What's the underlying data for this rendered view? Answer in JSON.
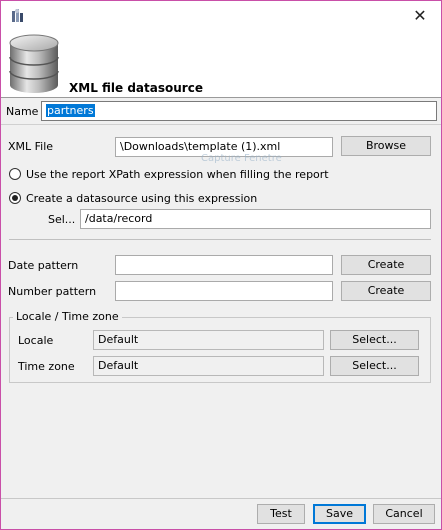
{
  "banner": {
    "title": "XML file datasource"
  },
  "name_row": {
    "label": "Name",
    "value": "partners"
  },
  "xml_file": {
    "label": "XML File",
    "value": "\\Downloads\\template (1).xml",
    "browse_label": "Browse"
  },
  "ghost_tooltip": "Capture Fenetre",
  "xpath_option": {
    "use_report_label": "Use the report XPath expression when filling the report",
    "create_label": "Create a datasource using this expression",
    "selected": "create"
  },
  "select_expr": {
    "label": "Sel...",
    "value": "/data/record"
  },
  "date_pattern": {
    "label": "Date pattern",
    "value": "",
    "button": "Create"
  },
  "number_pattern": {
    "label": "Number pattern",
    "value": "",
    "button": "Create"
  },
  "locale_group": {
    "legend": "Locale / Time zone",
    "locale": {
      "label": "Locale",
      "value": "Default",
      "button": "Select..."
    },
    "timezone": {
      "label": "Time zone",
      "value": "Default",
      "button": "Select..."
    }
  },
  "footer": {
    "test_label": "Test",
    "save_label": "Save",
    "cancel_label": "Cancel"
  },
  "colors": {
    "window_border": "#c94fa8",
    "selection": "#0078d7",
    "form_bg": "#f0f0f0"
  },
  "icons": {
    "app": "jasper-app-icon",
    "banner": "database-icon",
    "close": "close-icon"
  }
}
